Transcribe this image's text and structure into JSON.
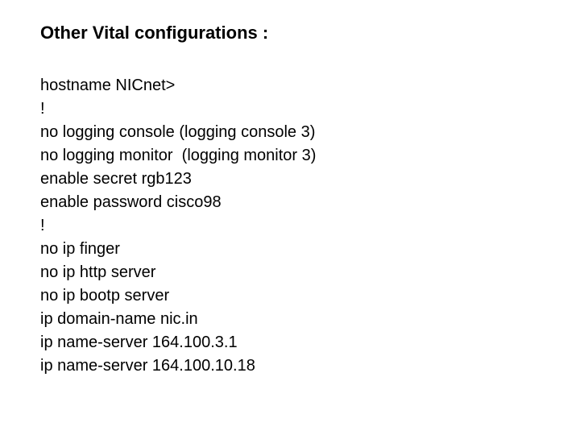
{
  "heading": "Other Vital configurations :",
  "config": {
    "l0": "hostname NICnet>",
    "l1": "!",
    "l2": "no logging console (logging console 3)",
    "l3": "no logging monitor  (logging monitor 3)",
    "l4": "enable secret rgb123",
    "l5": "enable password cisco98",
    "l6": "!",
    "l7": "no ip finger",
    "l8": "no ip http server",
    "l9": "no ip bootp server",
    "l10": "ip domain-name nic.in",
    "l11": "ip name-server 164.100.3.1",
    "l12": "ip name-server 164.100.10.18"
  }
}
